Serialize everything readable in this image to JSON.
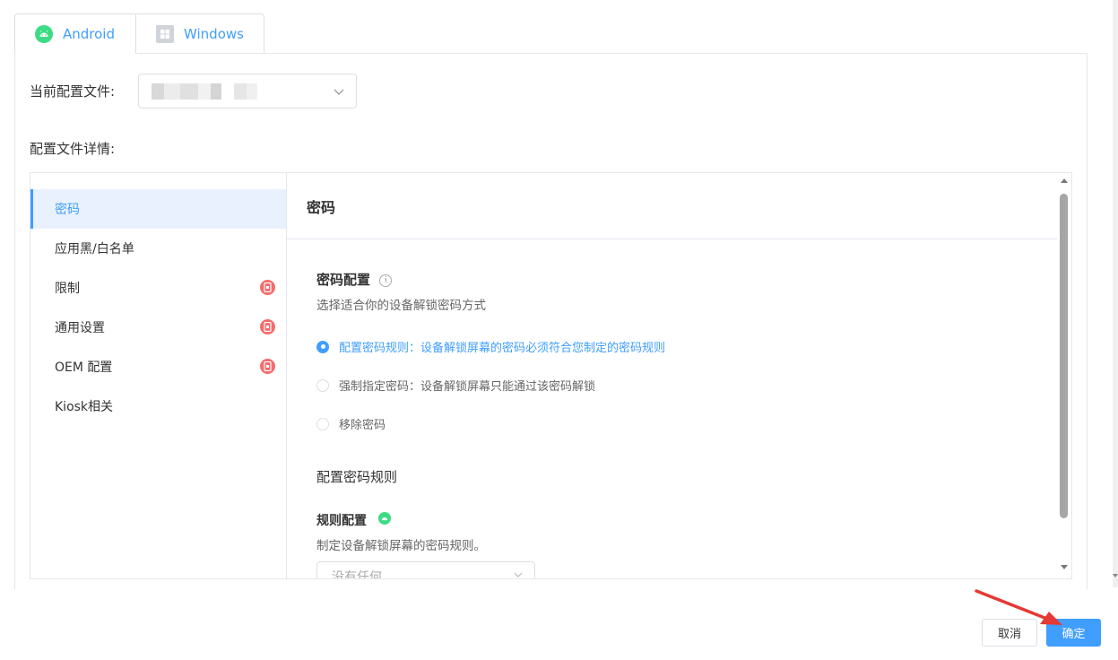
{
  "tabs": [
    {
      "label": "Android",
      "icon": "android-icon",
      "active": true
    },
    {
      "label": "Windows",
      "icon": "windows-icon",
      "active": false
    }
  ],
  "current_profile": {
    "label": "当前配置文件:",
    "value_obscured": true
  },
  "details_label": "配置文件详情:",
  "sidebar": {
    "items": [
      {
        "label": "密码",
        "active": true,
        "badge": false
      },
      {
        "label": "应用黑/白名单",
        "active": false,
        "badge": false
      },
      {
        "label": "限制",
        "active": false,
        "badge": true
      },
      {
        "label": "通用设置",
        "active": false,
        "badge": true
      },
      {
        "label": "OEM 配置",
        "active": false,
        "badge": true
      },
      {
        "label": "Kiosk相关",
        "active": false,
        "badge": false
      }
    ]
  },
  "content": {
    "title": "密码",
    "password_config": {
      "title": "密码配置",
      "info_icon": "info-icon",
      "desc": "选择适合你的设备解锁密码方式",
      "options": [
        {
          "label": "配置密码规则：设备解锁屏幕的密码必须符合您制定的密码规则",
          "checked": true
        },
        {
          "label": "强制指定密码：设备解锁屏幕只能通过该密码解锁",
          "checked": false
        },
        {
          "label": "移除密码",
          "checked": false
        }
      ]
    },
    "rules_section": {
      "title": "配置密码规则"
    },
    "rule_config": {
      "title": "规则配置",
      "icon": "android-icon",
      "desc": "制定设备解锁屏幕的密码规则。",
      "select_placeholder": "没有任何"
    }
  },
  "footer": {
    "cancel_label": "取消",
    "ok_label": "确定"
  },
  "colors": {
    "primary": "#409eff",
    "badge": "#f56c6c",
    "android_green": "#3ddc84",
    "annotation_arrow": "#e53935"
  }
}
